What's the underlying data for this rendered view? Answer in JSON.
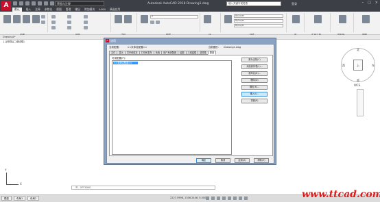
{
  "app": {
    "logo": "A",
    "workspace": "草图与注释",
    "title": "Autodesk AutoCAD 2018    Drawing1.dwg",
    "search_placeholder": "键入关键字或短语",
    "login": "登录",
    "window_buttons": [
      "–",
      "□",
      "×"
    ]
  },
  "menu": [
    "默认",
    "插入",
    "注释",
    "参数化",
    "视图",
    "管理",
    "输出",
    "附加模块",
    "A360",
    "精选应用"
  ],
  "ribbon": {
    "groups": [
      "绘图",
      "修改",
      "注释",
      "图层",
      "块",
      "特性",
      "组",
      "实用工具",
      "剪贴板",
      "视图"
    ],
    "layer_combo": "0",
    "bylayer": [
      "ByLayer",
      "ByLayer",
      "ByLayer"
    ]
  },
  "file_tab": "Drawing1*",
  "viewport_label": "[-][俯视][二维线框]",
  "viewcube": {
    "face": "上",
    "north": "北",
    "south": "南",
    "west": "西",
    "east": "东",
    "wcs": "WCS"
  },
  "axis": {
    "y": "Y",
    "x": "X"
  },
  "command_line": "☰ - OPTIONS",
  "status": {
    "tabs": [
      "模型",
      "布局1",
      "布局2"
    ],
    "coords": "2227.5998, 1306.2446, 0.0000",
    "model": "模型"
  },
  "dialog": {
    "title": "选项",
    "current_profile_label": "当前配置:",
    "current_profile": "<<未命名配置>>",
    "current_drawing_label": "当前图形:",
    "current_drawing": "Drawing1.dwg",
    "tabs": [
      "文件",
      "显示",
      "打开和保存",
      "打印和发布",
      "系统",
      "用户系统配置",
      "绘图",
      "三维建模",
      "选择集",
      "配置"
    ],
    "selected_tab": 9,
    "available_label": "可用配置(P):",
    "profiles": [
      "<<未命名配置>>"
    ],
    "side_buttons": [
      "置为当前(C)",
      "添加到列表(L)...",
      "重命名(N)...",
      "删除(D)",
      "输出(X)...",
      "输入(I)...",
      "重置(R)"
    ],
    "highlighted_button": 5,
    "footer": [
      "确定",
      "取消",
      "应用(A)",
      "帮助(H)"
    ]
  },
  "watermark": "www.ttcad.com"
}
